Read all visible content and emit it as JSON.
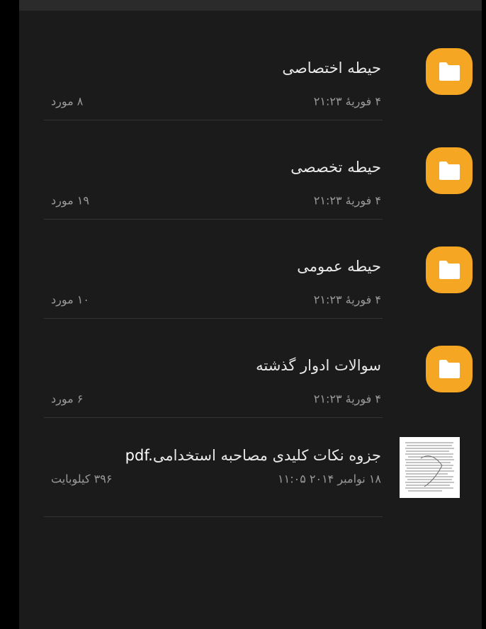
{
  "colors": {
    "folder": "#f5a623",
    "panel": "#1b1b1b",
    "title_text": "#e8e8e8",
    "meta_text": "#9a9a9a"
  },
  "folders": [
    {
      "name": "حیطه اختصاصی",
      "date": "۴ فوریهٔ ۲۱:۲۳",
      "count": "۸ مورد",
      "icon": "folder-icon"
    },
    {
      "name": "حیطه تخصصی",
      "date": "۴ فوریهٔ ۲۱:۲۳",
      "count": "۱۹ مورد",
      "icon": "folder-icon"
    },
    {
      "name": "حیطه عمومی",
      "date": "۴ فوریهٔ ۲۱:۲۳",
      "count": "۱۰ مورد",
      "icon": "folder-icon"
    },
    {
      "name": "سوالات ادوار گذشته",
      "date": "۴ فوریهٔ ۲۱:۲۳",
      "count": "۶ مورد",
      "icon": "folder-icon"
    }
  ],
  "file": {
    "name": "جزوه نکات کلیدی مصاحبه استخدامی",
    "ext": "pdf.",
    "date": "۱۸ نوامبر ۲۰۱۴ ۱۱:۰۵",
    "size": "۳۹۶ کیلوبایت",
    "icon": "pdf-thumbnail"
  }
}
